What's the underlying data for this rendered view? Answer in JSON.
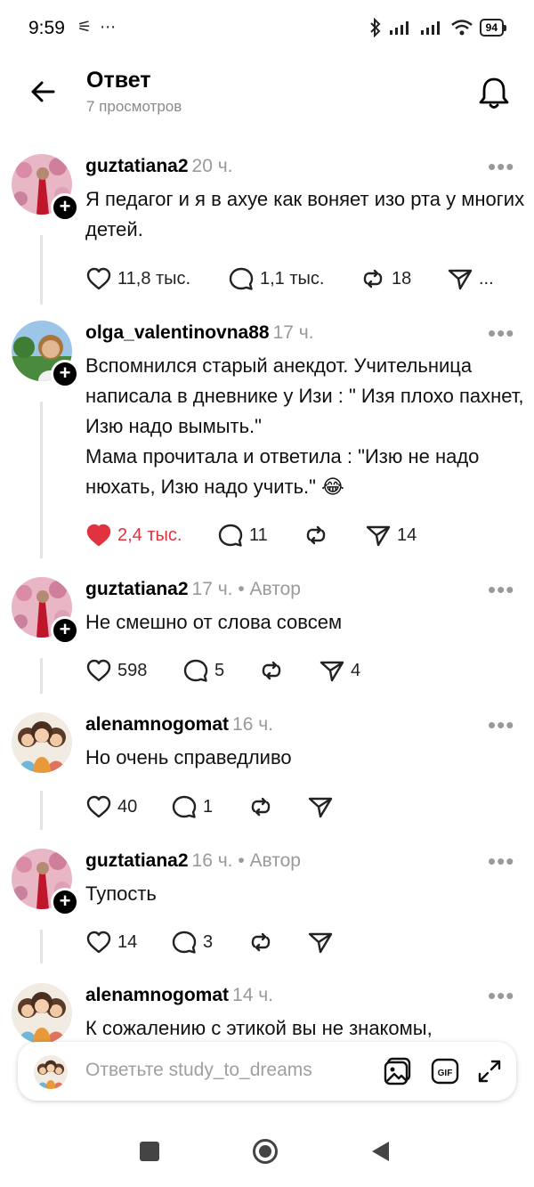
{
  "status": {
    "time": "9:59",
    "left_icons": "⚟ ⋯",
    "battery": "94"
  },
  "header": {
    "title": "Ответ",
    "views": "7 просмотров"
  },
  "posts": [
    {
      "user": "guztatiana2",
      "meta": "20 ч.",
      "text": "Я педагог и я в ахуе как воняет изо рта у многих детей.",
      "likes": "11,8 тыс.",
      "replies": "1,1 тыс.",
      "reposts": "18",
      "shares": "..."
    },
    {
      "user": "olga_valentinovna88",
      "meta": "17 ч.",
      "text": "Вспомнился старый анекдот.  Учительница написала в дневнике у Изи : \" Изя плохо пахнет, Изю надо вымыть.\"\nМама прочитала и ответила : \"Изю не надо нюхать, Изю надо учить.\" 😂",
      "likes": "2,4 тыс.",
      "replies": "11",
      "reposts": "",
      "shares": "14"
    },
    {
      "user": "guztatiana2",
      "meta": "17 ч. • Автор",
      "text": "Не смешно от слова совсем",
      "likes": "598",
      "replies": "5",
      "reposts": "",
      "shares": "4"
    },
    {
      "user": "alenamnogomat",
      "meta": "16 ч.",
      "text": "Но очень справедливо",
      "likes": "40",
      "replies": "1",
      "reposts": "",
      "shares": ""
    },
    {
      "user": "guztatiana2",
      "meta": "16 ч. • Автор",
      "text": "Тупость",
      "likes": "14",
      "replies": "3",
      "reposts": "",
      "shares": ""
    },
    {
      "user": "alenamnogomat",
      "meta": "14 ч.",
      "text": "К сожалению с этикой вы не знакомы,"
    }
  ],
  "reply": {
    "placeholder": "Ответьте study_to_dreams",
    "gif": "GIF"
  },
  "colors": {
    "like_active": "#e0333f",
    "muted": "#9a9a9a",
    "thread": "#e4e4e4"
  }
}
